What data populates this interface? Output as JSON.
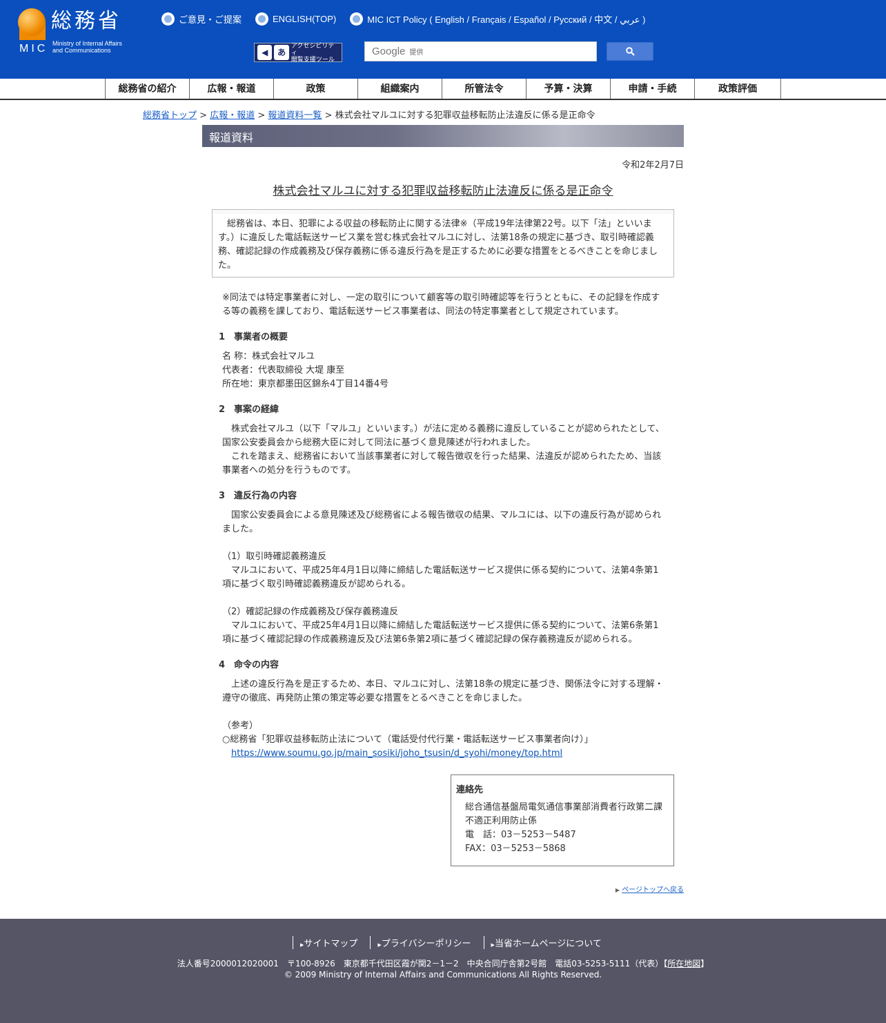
{
  "header": {
    "logo_kanji": "総務省",
    "logo_abbr": "MIC",
    "logo_en_1": "Ministry of Internal Affairs",
    "logo_en_2": "and Communications",
    "links": [
      "ご意見・ご提案",
      "ENGLISH(TOP)",
      "MIC ICT Policy ( English / Français / Español / Русский / 中文 / عربي )"
    ],
    "access_label_1": "アクセシビリティ",
    "access_label_2": "閲覧支援ツール",
    "search_brand": "Google",
    "search_sub": "提供"
  },
  "nav": [
    "総務省の紹介",
    "広報・報道",
    "政策",
    "組織案内",
    "所管法令",
    "予算・決算",
    "申請・手続",
    "政策評価"
  ],
  "breadcrumb": {
    "home": "総務省トップ",
    "pr": "広報・報道",
    "list": "報道資料一覧",
    "sep": " > ",
    "current": "株式会社マルユに対する犯罪収益移転防止法違反に係る是正命令"
  },
  "section_title": "報道資料",
  "date": "令和2年2月7日",
  "title": "株式会社マルユに対する犯罪収益移転防止法違反に係る是正命令",
  "summary": "　総務省は、本日、犯罪による収益の移転防止に関する法律※（平成19年法律第22号。以下「法」といいます。）に違反した電話転送サービス業を営む株式会社マルユに対し、法第18条の規定に基づき、取引時確認義務、確認記録の作成義務及び保存義務に係る違反行為を是正するために必要な措置をとるべきことを命じました。",
  "note": "※同法では特定事業者に対し、一定の取引について顧客等の取引時確認等を行うとともに、その記録を作成する等の義務を課しており、電話転送サービス事業者は、同法の特定事業者として規定されています。",
  "sec1": {
    "heading": "1　事業者の概要",
    "lines": [
      "名 称：株式会社マルユ",
      "代表者：代表取締役 大堤 康至",
      "所在地：東京都墨田区錦糸4丁目14番4号"
    ]
  },
  "sec2": {
    "heading": "2　事案の経緯",
    "p1": "　株式会社マルユ（以下「マルユ」といいます。）が法に定める義務に違反していることが認められたとして、国家公安委員会から総務大臣に対して同法に基づく意見陳述が行われました。",
    "p2": "　これを踏まえ、総務省において当該事業者に対して報告徴収を行った結果、法違反が認められたため、当該事業者への処分を行うものです。"
  },
  "sec3": {
    "heading": "3　違反行為の内容",
    "intro": "　国家公安委員会による意見陳述及び総務省による報告徴収の結果、マルユには、以下の違反行為が認められました。",
    "item1_title": "（1）取引時確認義務違反",
    "item1_body": "　マルユにおいて、平成25年4月1日以降に締結した電話転送サービス提供に係る契約について、法第4条第1項に基づく取引時確認義務違反が認められる。",
    "item2_title": "（2）確認記録の作成義務及び保存義務違反",
    "item2_body": "　マルユにおいて、平成25年4月1日以降に締結した電話転送サービス提供に係る契約について、法第6条第1項に基づく確認記録の作成義務違反及び法第6条第2項に基づく確認記録の保存義務違反が認められる。"
  },
  "sec4": {
    "heading": "4　命令の内容",
    "body": "　上述の違反行為を是正するため、本日、マルユに対し、法第18条の規定に基づき、関係法令に対する理解・遵守の徹底、再発防止策の策定等必要な措置をとるべきことを命じました。",
    "ref_label": "（参考）",
    "ref_title": "○総務省「犯罪収益移転防止法について（電話受付代行業・電話転送サービス事業者向け）」",
    "ref_url": "https://www.soumu.go.jp/main_sosiki/joho_tsusin/d_syohi/money/top.html"
  },
  "contact": {
    "title": "連絡先",
    "lines": [
      "総合通信基盤局電気通信事業部消費者行政第二課",
      "不適正利用防止係",
      "電　話：03－5253－5487",
      "FAX：03－5253－5868"
    ]
  },
  "pagetop": "ページトップへ戻る",
  "footer": {
    "links": [
      "サイトマップ",
      "プライバシーポリシー",
      "当省ホームページについて"
    ],
    "address": "法人番号2000012020001　〒100-8926　東京都千代田区霞が関2－1－2　中央合同庁舎第2号館　電話03-5253-5111（代表）",
    "map_open": "【",
    "map_label": "所在地図",
    "map_close": "】",
    "copyright": "© 2009 Ministry of Internal Affairs and Communications All Rights Reserved."
  }
}
